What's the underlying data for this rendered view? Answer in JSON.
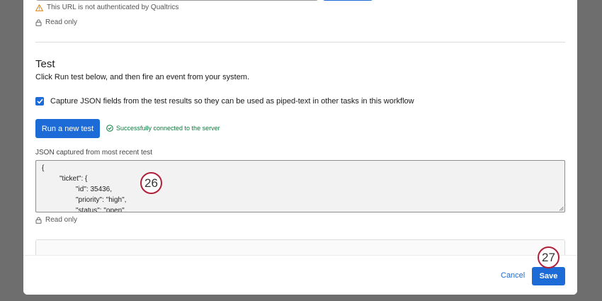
{
  "url_section": {
    "warning_text": "This URL is not authenticated by Qualtrics",
    "readonly_text": "Read only"
  },
  "test_section": {
    "title": "Test",
    "description": "Click Run test below, and then fire an event from your system.",
    "capture_checkbox_label": "Capture JSON fields from the test results so they can be used as piped-text in other tasks in this workflow",
    "capture_checked": true,
    "run_button_label": "Run a new test",
    "status_text": "Successfully connected to the server",
    "json_label": "JSON captured from most recent test",
    "json_lines": [
      "{",
      "\"ticket\": {",
      "\"id\": 35436,",
      "\"priority\": \"high\",",
      "\"status\": \"open\","
    ],
    "readonly_text": "Read only"
  },
  "footer": {
    "cancel_label": "Cancel",
    "save_label": "Save"
  },
  "annotations": {
    "step_a": "26",
    "step_b": "27",
    "badge_color": "#b0203a"
  },
  "colors": {
    "accent": "#1d6bd6",
    "success": "#0b7a3e",
    "overlay": "#6e6e6e"
  }
}
